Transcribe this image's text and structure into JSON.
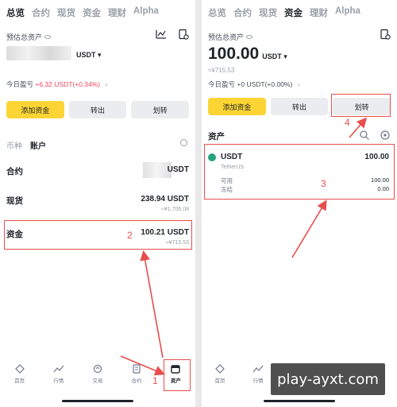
{
  "tabs": [
    "总览",
    "合约",
    "现货",
    "资金",
    "理财",
    "Alpha"
  ],
  "left": {
    "active_tab_index": 0,
    "estimated_label": "预估总资产",
    "balance_unit": "USDT ▾",
    "today_pnl_label": "今日盈亏",
    "today_pnl_value": "+6.32 USDT(+0.34%)",
    "pnl_chevron": "›",
    "buttons": {
      "add_funds": "添加资金",
      "withdraw": "转出",
      "transfer": "划转"
    },
    "sub_tabs": [
      "币种",
      "账户"
    ],
    "rows": [
      {
        "name": "合约",
        "value": "USDT",
        "sub": ""
      },
      {
        "name": "现货",
        "value": "238.94 USDT",
        "sub": "≈¥1,706.08"
      },
      {
        "name": "资金",
        "value": "100.21 USDT",
        "sub": "≈¥715.53"
      }
    ],
    "nav": [
      "首页",
      "行情",
      "交易",
      "合约",
      "资产"
    ],
    "annotations": {
      "funds": "2",
      "assets_nav": "1"
    }
  },
  "right": {
    "active_tab_index": 3,
    "estimated_label": "预估总资产",
    "balance": "100.00",
    "balance_unit": "USDT ▾",
    "approx": "≈¥715.53",
    "today_pnl_label": "今日盈亏",
    "today_pnl_value": "+0 USDT(+0.00%)",
    "pnl_chevron": "›",
    "buttons": {
      "add_funds": "添加资金",
      "withdraw": "转出",
      "transfer": "划转"
    },
    "assets_title": "资产",
    "coin": {
      "symbol": "USDT",
      "fullname": "TetherUS",
      "total": "100.00",
      "available_label": "可用",
      "available": "100.00",
      "frozen_label": "冻结",
      "frozen": "0.00"
    },
    "nav": [
      "首页",
      "行情"
    ],
    "annotations": {
      "coin": "3",
      "transfer": "4"
    }
  },
  "watermark": "play-ayxt.com",
  "colors": {
    "accent_yellow": "#fcd535",
    "annotation_red": "#e84d4d",
    "loss_red": "#f6465d",
    "usdt_green": "#26a17b"
  },
  "icons": [
    "eye-icon",
    "chart-icon",
    "wallet-history-icon",
    "search-icon",
    "settings-icon",
    "home-icon",
    "market-icon",
    "trade-icon",
    "futures-icon",
    "assets-icon"
  ]
}
